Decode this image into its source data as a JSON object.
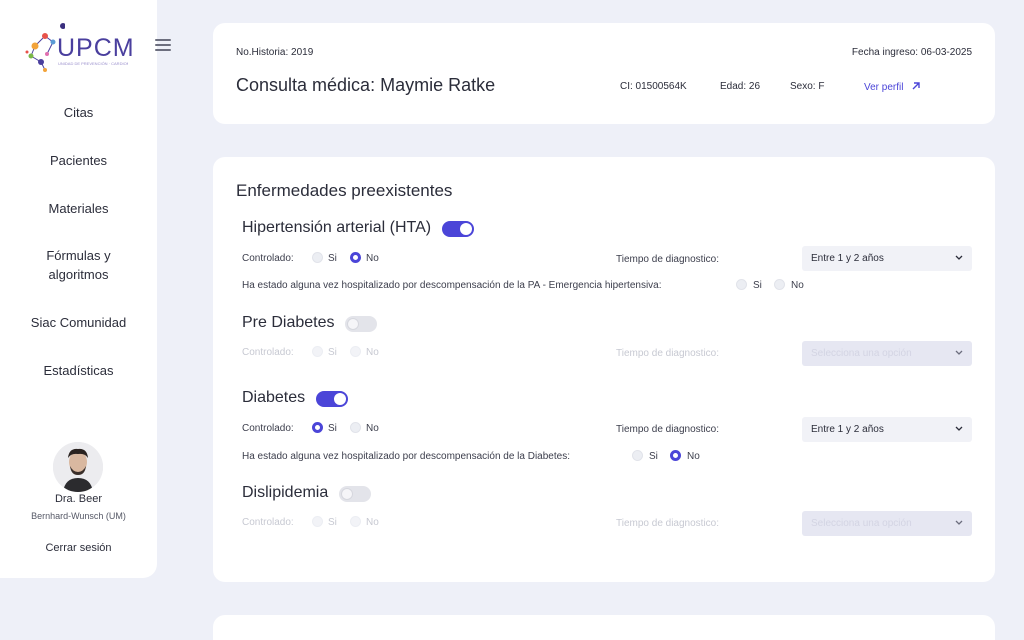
{
  "sidebar": {
    "logo_text": "UPCM",
    "logo_subtitle": "UNIDAD DE PREVENCIÓN · CARDIOMETABÓLICA",
    "menu_icon": "hamburger-menu-icon",
    "items": [
      {
        "label": "Citas"
      },
      {
        "label": "Pacientes"
      },
      {
        "label": "Materiales"
      },
      {
        "label": "Fórmulas y algoritmos"
      },
      {
        "label": "Siac Comunidad"
      },
      {
        "label": "Estadísticas"
      }
    ],
    "user": {
      "name": "Dra. Beer",
      "role": "Bernhard-Wunsch (UM)"
    },
    "logout_label": "Cerrar sesión"
  },
  "header": {
    "historia": "No.Historia: 2019",
    "fecha_ingreso": "Fecha ingreso: 06-03-2025",
    "title": "Consulta médica: Maymie Ratke",
    "ci": "CI: 01500564K",
    "edad": "Edad: 26",
    "sexo": "Sexo: F",
    "ver_perfil": "Ver perfil",
    "ver_perfil_icon": "arrow-up-right-icon"
  },
  "enfermedades": {
    "title": "Enfermedades preexistentes",
    "controlado_label": "Controlado:",
    "si_label": "Si",
    "no_label": "No",
    "tiempo_label": "Tiempo de diagnostico:",
    "placeholder": "Selecciona una opción",
    "conditions": [
      {
        "name": "Hipertensión arterial (HTA)",
        "enabled": true,
        "controlado": "No",
        "tiempo": "Entre 1 y 2 años",
        "hospitalizado_label": "Ha estado alguna vez hospitalizado por descompensación de la PA - Emergencia hipertensiva:",
        "hospitalizado": null
      },
      {
        "name": "Pre Diabetes",
        "enabled": false,
        "controlado": null,
        "tiempo": null
      },
      {
        "name": "Diabetes",
        "enabled": true,
        "controlado": "Si",
        "tiempo": "Entre 1 y 2 años",
        "hospitalizado_label": "Ha estado alguna vez hospitalizado por descompensación de la Diabetes:",
        "hospitalizado": "No"
      },
      {
        "name": "Dislipidemia",
        "enabled": false,
        "controlado": null,
        "tiempo": null
      }
    ]
  },
  "colors": {
    "accent": "#4b45d8",
    "background": "#eef0f8",
    "card": "#ffffff"
  }
}
